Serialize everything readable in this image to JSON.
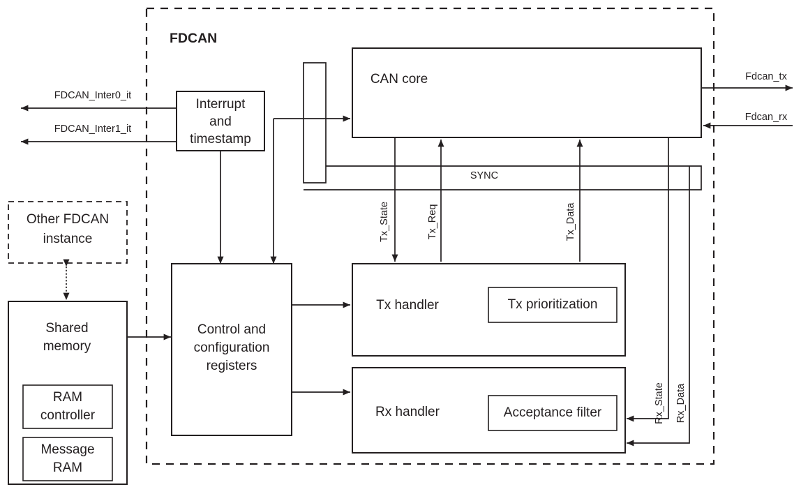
{
  "diagram": {
    "title": "FDCAN",
    "blocks": {
      "can_core": "CAN core",
      "interrupt": [
        "Interrupt",
        "and",
        "timestamp"
      ],
      "other_instance": [
        "Other FDCAN",
        "instance"
      ],
      "shared_memory": [
        "Shared",
        "memory"
      ],
      "ram_controller": [
        "RAM",
        "controller"
      ],
      "message_ram": [
        "Message",
        "RAM"
      ],
      "control_registers": [
        "Control and",
        "configuration",
        "registers"
      ],
      "tx_handler": "Tx handler",
      "tx_prioritization": "Tx prioritization",
      "rx_handler": "Rx handler",
      "acceptance_filter": "Acceptance filter"
    },
    "signals": {
      "inter0": "FDCAN_Inter0_it",
      "inter1": "FDCAN_Inter1_it",
      "fdcan_tx": "Fdcan_tx",
      "fdcan_rx": "Fdcan_rx",
      "sync": "SYNC",
      "tx_state": "Tx_State",
      "tx_req": "Tx_Req",
      "tx_data": "Tx_Data",
      "rx_state": "Rx_State",
      "rx_data": "Rx_Data"
    },
    "colors": {
      "stroke": "#231f20",
      "fill": "#ffffff"
    }
  }
}
